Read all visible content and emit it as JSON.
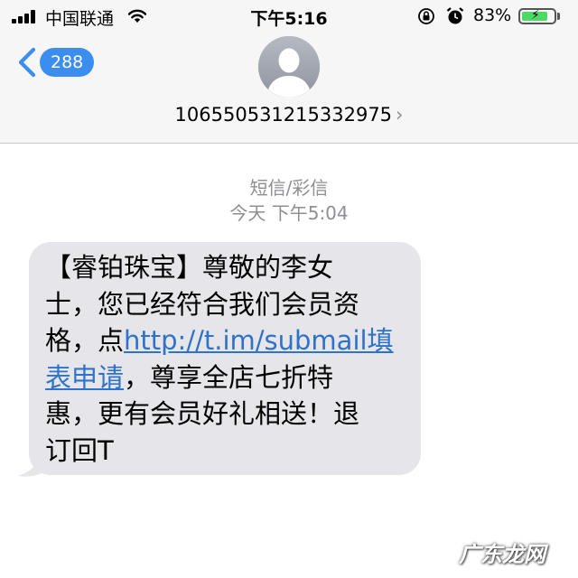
{
  "status_bar": {
    "carrier": "中国联通",
    "time": "下午5:16",
    "battery": "83%",
    "battery_level": 0.83,
    "battery_color": "#4cd964"
  },
  "nav": {
    "back_icon": "chevron-left-icon",
    "unread_count": "288",
    "avatar_icon": "person-silhouette-icon",
    "contact_number": "106550531215332975",
    "contact_chevron": "›"
  },
  "conversation": {
    "message_type": "短信/彩信",
    "timestamp": "今天 下午5:04",
    "message": {
      "line1": "【睿铂珠宝】尊敬的李女",
      "line2": "士，您已经符合我们会员资",
      "line3_prefix": "格，点",
      "link_part1": "http://t.im/submail填",
      "link_part2": "表申请",
      "line4_suffix": "，尊享全店七折特",
      "line5": "惠，更有会员好礼相送！退",
      "line6": "订回T"
    }
  },
  "watermark": "广东龙网",
  "colors": {
    "accent": "#3b8ef0",
    "link": "#2e73c9",
    "bubble": "#e5e5ea",
    "header_bg": "#f6f6f7"
  }
}
